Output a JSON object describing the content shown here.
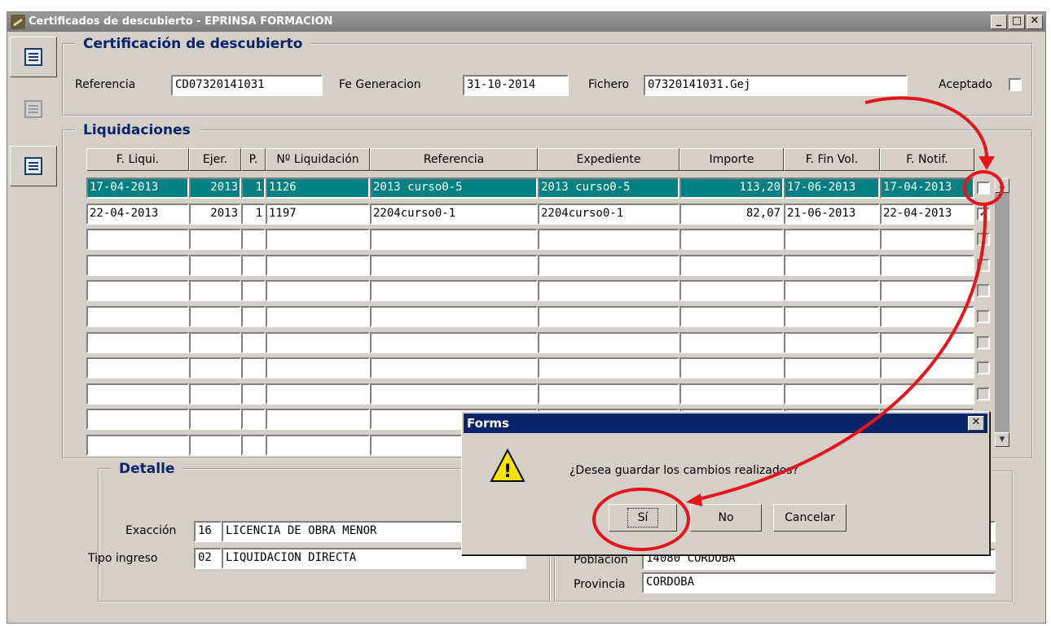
{
  "window": {
    "title": "Certificados de descubierto - EPRINSA FORMACION",
    "min": "_",
    "max": "□",
    "close": "✕"
  },
  "cert": {
    "legend": "Certificación de descubierto",
    "ref_label": "Referencia",
    "ref_value": "CD07320141031",
    "fecha_label": "Fe Generacion",
    "fecha_value": "31-10-2014",
    "fichero_label": "Fichero",
    "fichero_value": "07320141031.Gej",
    "aceptado_label": "Aceptado"
  },
  "liq": {
    "legend": "Liquidaciones",
    "headers": [
      "F. Liqui.",
      "Ejer.",
      "P.",
      "Nº Liquidación",
      "Referencia",
      "Expediente",
      "Importe",
      "F. Fin Vol.",
      "F. Notif."
    ],
    "rows": [
      [
        "17-04-2013",
        "2013",
        "1",
        "1126",
        "2013 curso0-5",
        "2013 curso0-5",
        "113,20",
        "17-06-2013",
        "17-04-2013"
      ],
      [
        "22-04-2013",
        "2013",
        "1",
        "1197",
        "2204curso0-1",
        "2204curso0-1",
        "82,07",
        "21-06-2013",
        "22-04-2013"
      ]
    ],
    "checks": [
      "",
      "✓"
    ]
  },
  "detalle": {
    "legend": "Detalle",
    "exaccion_label": "Exacción",
    "exaccion_code": "16",
    "exaccion_value": "LICENCIA DE OBRA MENOR",
    "tipo_label": "Tipo ingreso",
    "tipo_code": "02",
    "tipo_value": "LIQUIDACION DIRECTA"
  },
  "addr": {
    "poblacion_label": "Poblacion",
    "poblacion_value": "14080 CORDOBA",
    "provincia_label": "Provincia",
    "provincia_value": "CORDOBA"
  },
  "dialog": {
    "title": "Forms",
    "close": "✕",
    "icon_glyph": "!",
    "message": "¿Desea guardar los cambios realizados?",
    "yes": "Sí",
    "no": "No",
    "cancel": "Cancelar"
  },
  "colors": {
    "annotation": "#e8141c",
    "selected_row": "#008080",
    "legend_text": "#0a246a",
    "dialog_title": "#0a246a"
  }
}
